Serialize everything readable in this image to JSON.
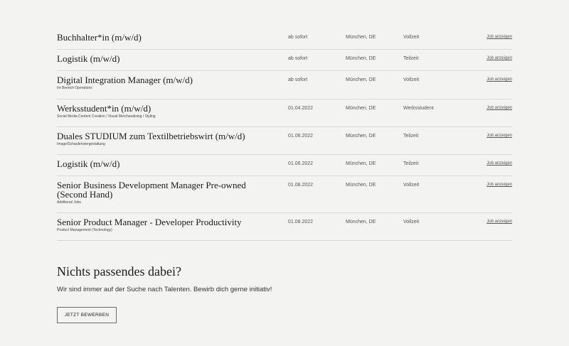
{
  "jobs": [
    {
      "title": "Buchhalter*in (m/w/d)",
      "subtitle": "",
      "start": "ab sofort",
      "location": "München, DE",
      "type": "Vollzeit",
      "link": "Job anzeigen"
    },
    {
      "title": "Logistik (m/w/d)",
      "subtitle": "",
      "start": "ab sofort",
      "location": "München, DE",
      "type": "Teilzeit",
      "link": "Job anzeigen"
    },
    {
      "title": "Digital Integration Manager (m/w/d)",
      "subtitle": "Im Bereich Operations",
      "start": "ab sofort",
      "location": "München, DE",
      "type": "Vollzeit",
      "link": "Job anzeigen"
    },
    {
      "title": "Werksstudent*in (m/w/d)",
      "subtitle": "Social Media Content Creation / Visual Merchandising / Styling",
      "start": "01.04.2022",
      "location": "München, DE",
      "type": "Werksstudent",
      "link": "Job anzeigen"
    },
    {
      "title": "Duales STUDIUM zum Textilbetriebswirt (m/w/d)",
      "subtitle": "Image/Schaufenstergestaltung",
      "start": "01.06.2022",
      "location": "München, DE",
      "type": "Teilzeit",
      "link": "Job anzeigen"
    },
    {
      "title": "Logistik (m/w/d)",
      "subtitle": "",
      "start": "01.06.2022",
      "location": "München, DE",
      "type": "Teilzeit",
      "link": "Job anzeigen"
    },
    {
      "title": "Senior Business Development Manager Pre-owned (Second Hand)",
      "subtitle": "Additional Jobs",
      "start": "01.08.2022",
      "location": "München, DE",
      "type": "Vollzeit",
      "link": "Job anzeigen"
    },
    {
      "title": "Senior Product Manager - Developer Productivity",
      "subtitle": "Product Management (Technology)",
      "start": "01.08.2022",
      "location": "München, DE",
      "type": "Vollzeit",
      "link": "Job anzeigen"
    }
  ],
  "cta": {
    "heading": "Nichts passendes dabei?",
    "text": "Wir sind immer auf der Suche nach Talenten. Bewirb dich gerne initiativ!",
    "button_label": "JETZT BEWERBEN"
  }
}
